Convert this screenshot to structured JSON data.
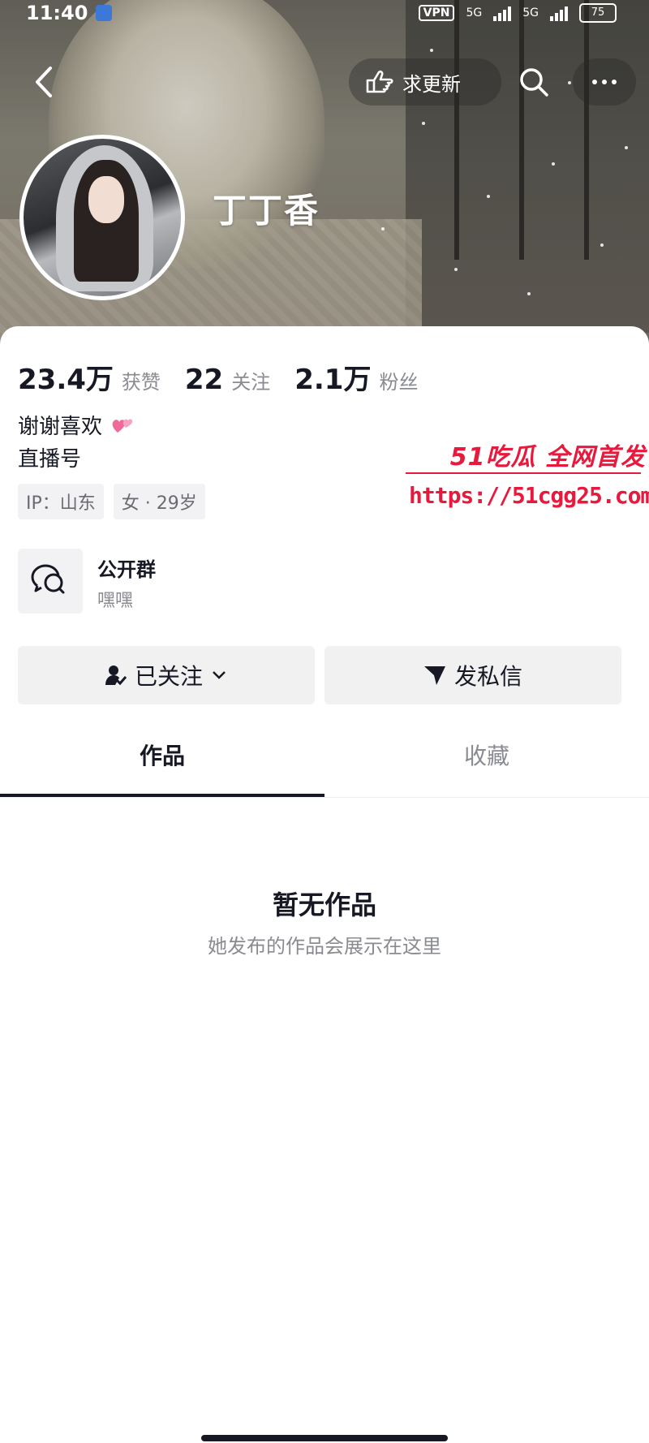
{
  "status_bar": {
    "time": "11:40",
    "vpn": "VPN",
    "net1": "5G",
    "net2": "5G",
    "battery": "75"
  },
  "nav": {
    "update_label": "求更新"
  },
  "profile": {
    "nickname": "丁丁香",
    "stats": [
      {
        "num": "23.4万",
        "label": "获赞"
      },
      {
        "num": "22",
        "label": "关注"
      },
      {
        "num": "2.1万",
        "label": "粉丝"
      }
    ],
    "bio_line1": "谢谢喜欢",
    "bio_line2": "直播号",
    "tags": [
      "IP：山东",
      "女 · 29岁"
    ]
  },
  "group": {
    "title": "公开群",
    "subtitle": "嘿嘿"
  },
  "actions": {
    "follow_label": "已关注",
    "message_label": "发私信"
  },
  "tabs": {
    "works": "作品",
    "favorites": "收藏"
  },
  "empty_state": {
    "title": "暂无作品",
    "subtitle": "她发布的作品会展示在这里"
  },
  "watermark": {
    "brand": "51吃瓜 全网首发",
    "url": "https://51cgg25.com"
  },
  "colors": {
    "accent_red": "#e8193c",
    "text_primary": "#161823",
    "text_secondary": "#8a8b91"
  }
}
